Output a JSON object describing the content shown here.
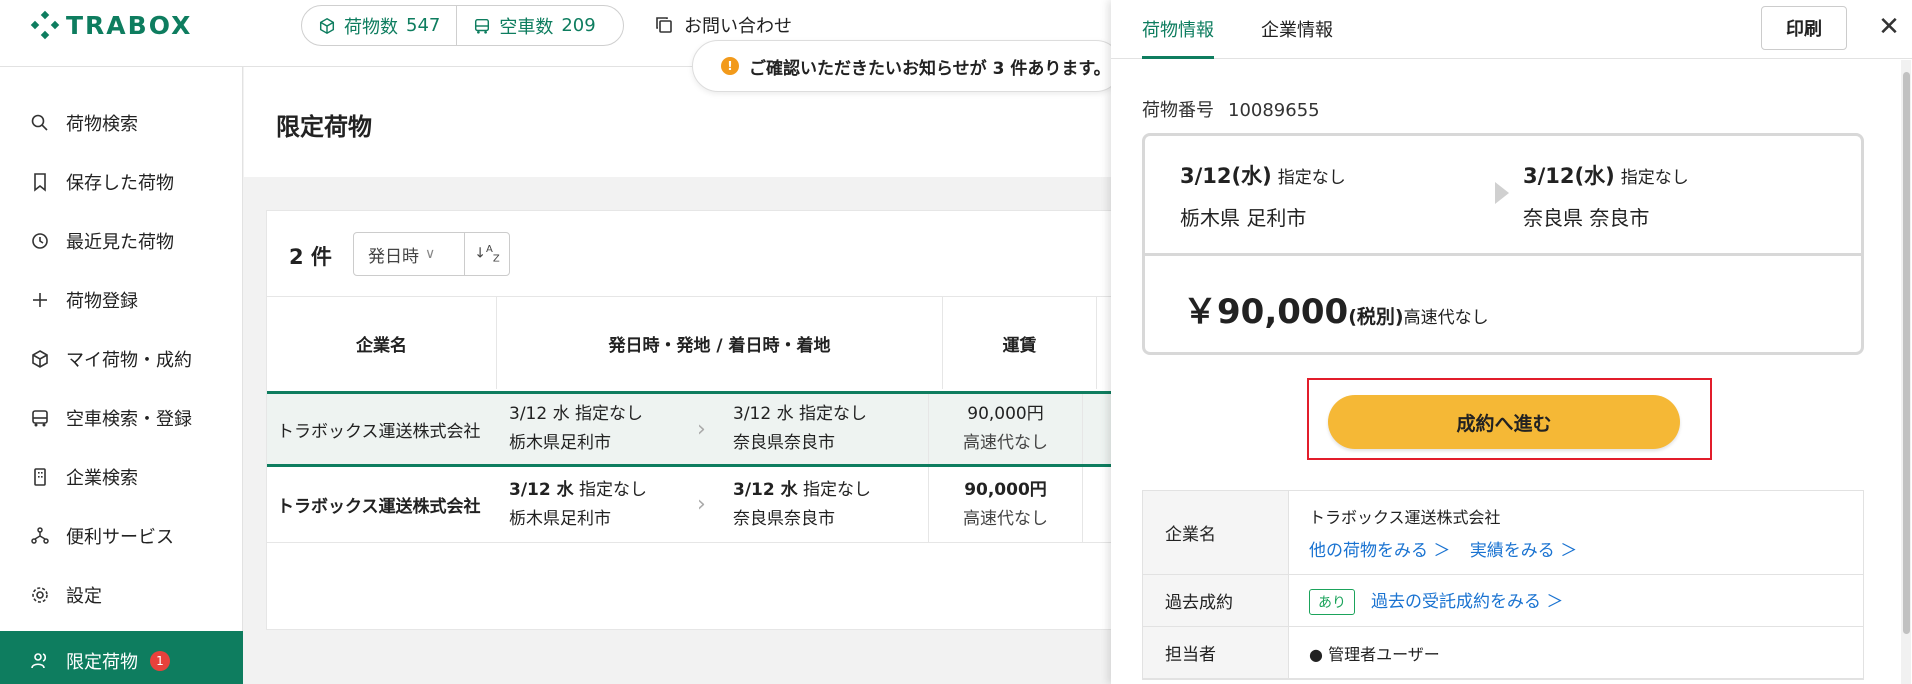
{
  "header": {
    "logo": "TRABOX",
    "stats": [
      {
        "label": "荷物数",
        "value": "547"
      },
      {
        "label": "空車数",
        "value": "209"
      }
    ],
    "contact": "お問い合わせ",
    "notice": "ご確認いただきたいお知らせが 3 件あります。"
  },
  "sidebar": {
    "items": [
      {
        "label": "荷物検索",
        "icon": "search-icon"
      },
      {
        "label": "保存した荷物",
        "icon": "bookmark-icon"
      },
      {
        "label": "最近見た荷物",
        "icon": "history-icon"
      },
      {
        "label": "荷物登録",
        "icon": "plus-icon"
      },
      {
        "label": "マイ荷物・成約",
        "icon": "box-icon"
      },
      {
        "label": "空車検索・登録",
        "icon": "truck-icon"
      },
      {
        "label": "企業検索",
        "icon": "building-icon"
      },
      {
        "label": "便利サービス",
        "icon": "network-icon"
      },
      {
        "label": "設定",
        "icon": "gear-icon"
      },
      {
        "label": "限定荷物",
        "icon": "users-icon",
        "badge": "1"
      }
    ]
  },
  "main": {
    "title": "限定荷物",
    "count": "2 件",
    "sort": "発日時",
    "columns": [
      "企業名",
      "発日時・発地 / 着日時・着地",
      "運賃"
    ],
    "rows": [
      {
        "company": "トラボックス運送株式会社",
        "from_date": "3/12 水",
        "from_time": "指定なし",
        "from_place": "栃木県足利市",
        "to_date": "3/12 水",
        "to_time": "指定なし",
        "to_place": "奈良県奈良市",
        "fare": "90,000円",
        "highway": "高速代なし"
      },
      {
        "company": "トラボックス運送株式会社",
        "from_date": "3/12 水",
        "from_time": "指定なし",
        "from_place": "栃木県足利市",
        "to_date": "3/12 水",
        "to_time": "指定なし",
        "to_place": "奈良県奈良市",
        "fare": "90,000円",
        "highway": "高速代なし"
      }
    ]
  },
  "panel": {
    "tabs": [
      "荷物情報",
      "企業情報"
    ],
    "print": "印刷",
    "cargo_label": "荷物番号",
    "cargo_no": "10089655",
    "from": {
      "date": "3/12(水)",
      "time": "指定なし",
      "place": "栃木県 足利市"
    },
    "to": {
      "date": "3/12(水)",
      "time": "指定なし",
      "place": "奈良県 奈良市"
    },
    "price": "￥90,000",
    "tax": "(税別)",
    "highway": "高速代なし",
    "cta": "成約へ進む",
    "info": {
      "company_label": "企業名",
      "company": "トラボックス運送株式会社",
      "link_other": "他の荷物をみる ＞",
      "link_results": "実績をみる ＞",
      "past_label": "過去成約",
      "past_pill": "あり",
      "past_link": "過去の受託成約をみる ＞",
      "person_label": "担当者",
      "person": "管理者ユーザー"
    }
  },
  "colors": {
    "brand": "#0e7d5f",
    "cta": "#f5b836",
    "highlight": "#e21d2b",
    "link": "#1a73d1"
  }
}
